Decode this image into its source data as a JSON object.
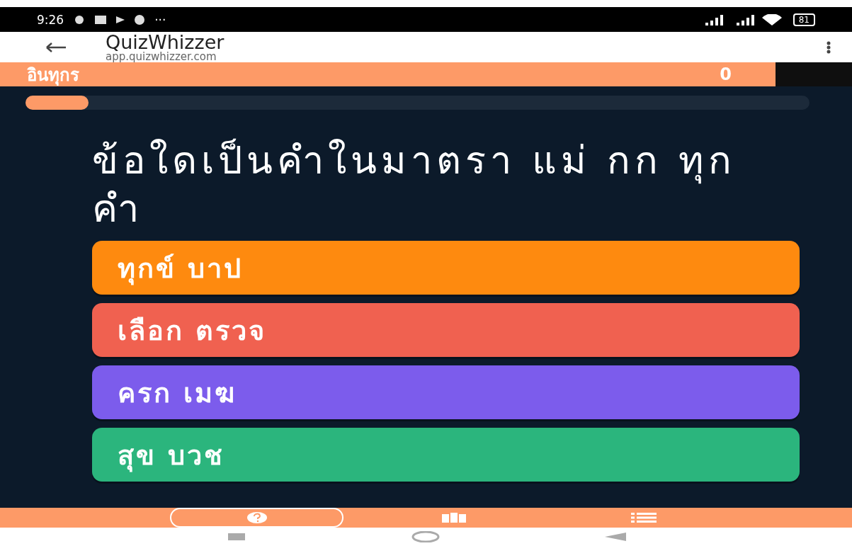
{
  "status_bar": {
    "time": "9:26",
    "more": "···",
    "battery": "81"
  },
  "browser": {
    "title": "QuizWhizzer",
    "url": "app.quizwhizzer.com"
  },
  "player": {
    "name": "อินทุกร",
    "score": "0"
  },
  "progress": {
    "level": 0.08
  },
  "question": "ข้อใดเป็นคำในมาตรา แม่ กก ทุกคำ",
  "answers": [
    {
      "text": "ทุกข์ บาป",
      "color": "#fe8a0f"
    },
    {
      "text": "เลือก ตรวจ",
      "color": "#f06150"
    },
    {
      "text": "ครก เมฆ",
      "color": "#7c5cec"
    },
    {
      "text": "สุข บวช",
      "color": "#2bb57d"
    }
  ],
  "bottom_nav": [
    {
      "kind": "question",
      "selected": true
    },
    {
      "kind": "map",
      "selected": false
    },
    {
      "kind": "list",
      "selected": false
    }
  ]
}
